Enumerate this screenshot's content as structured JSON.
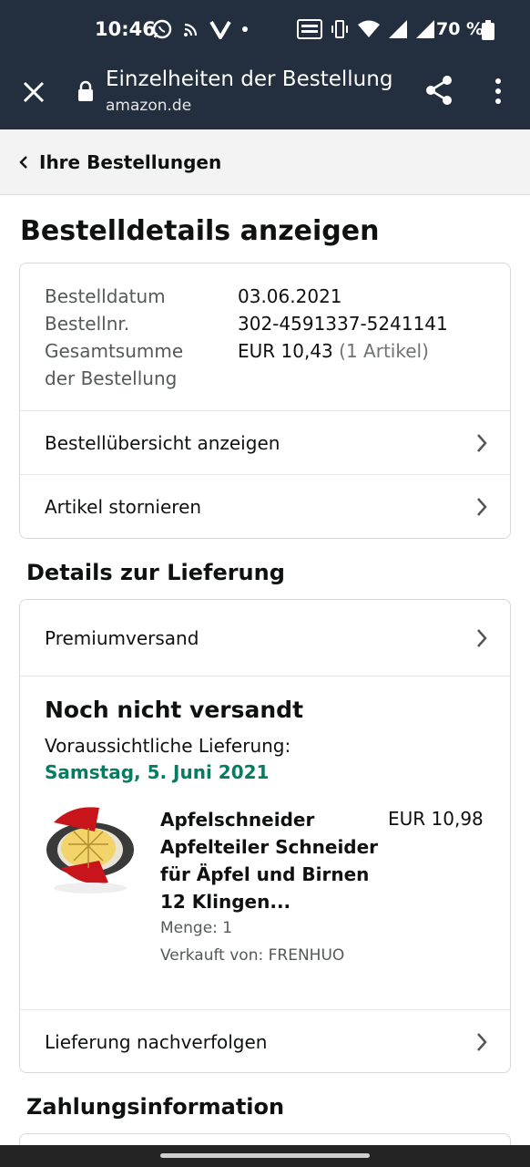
{
  "status_bar": {
    "time": "10:46",
    "battery": "70 %"
  },
  "app_bar": {
    "title": "Einzelheiten der Bestellung",
    "url": "amazon.de"
  },
  "breadcrumb": {
    "label": "Ihre Bestellungen"
  },
  "page": {
    "title": "Bestelldetails anzeigen"
  },
  "order_summary": {
    "date_label": "Bestelldatum",
    "date_value": "03.06.2021",
    "number_label": "Bestellnr.",
    "number_value": "302-4591337-5241141",
    "total_label_line1": "Gesamtsumme",
    "total_label_line2": "der Bestellung",
    "total_value": "EUR 10,43",
    "total_items": "(1 Artikel)",
    "link_overview": "Bestellübersicht anzeigen",
    "link_cancel": "Artikel stornieren"
  },
  "delivery": {
    "section_title": "Details zur Lieferung",
    "shipping_method": "Premiumversand",
    "status": "Noch nicht versandt",
    "expected_label": "Voraussichtliche Lieferung:",
    "expected_date": "Samstag, 5. Juni 2021",
    "colors": {
      "date_green": "#067d62"
    },
    "product": {
      "title": "Apfelschneider Apfelteiler Schneider für Äpfel und Birnen 12 Klingen...",
      "price": "EUR 10,98",
      "quantity": "Menge: 1",
      "seller": "Verkauft von: FRENHUO"
    },
    "track_link": "Lieferung nachverfolgen"
  },
  "payment": {
    "section_title": "Zahlungsinformation"
  }
}
